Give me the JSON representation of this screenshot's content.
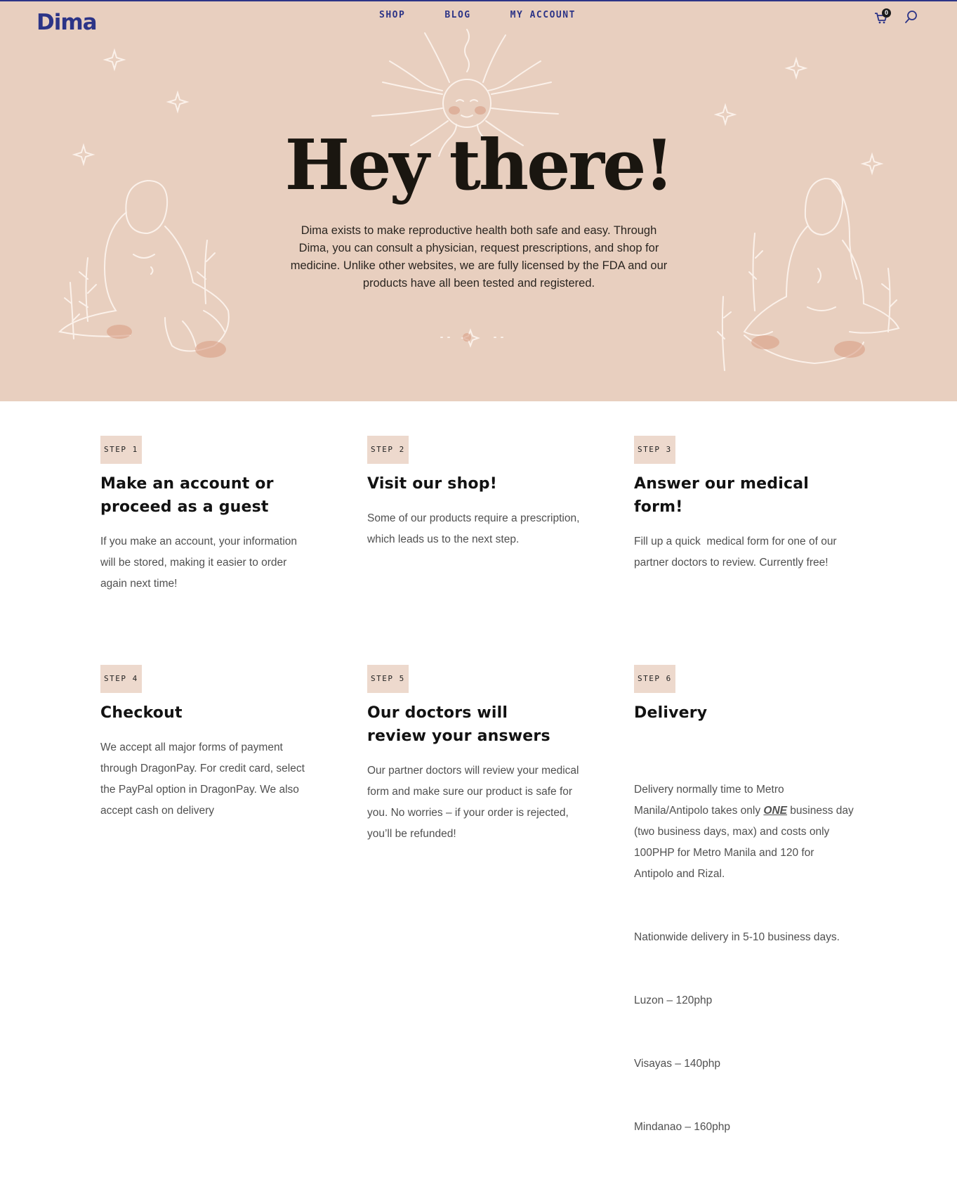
{
  "brand": {
    "logo": "Dima",
    "color": "#2c3487"
  },
  "nav": {
    "items": [
      "SHOP",
      "BLOG",
      "MY ACCOUNT"
    ]
  },
  "cart": {
    "count": "0"
  },
  "hero": {
    "title": "Hey there!",
    "text": "Dima exists to make reproductive health both safe and easy. Through Dima, you can consult a physician, request prescriptions, and shop for medicine. Unlike other websites, we are fully licensed by the FDA and our products have all been tested and registered.",
    "background": "#e8cfbf"
  },
  "steps": [
    {
      "badge": "STEP 1",
      "title": "Make an account or proceed as a guest",
      "desc": "If you make an account, your information will be stored, making it easier to order again next time!"
    },
    {
      "badge": "STEP 2",
      "title": "Visit our shop!",
      "desc": "Some of our products require a prescription, which leads us to the next step."
    },
    {
      "badge": "STEP 3",
      "title": "Answer our medical form!",
      "desc": "Fill up a quick  medical form for one of our partner doctors to review. Currently free!"
    },
    {
      "badge": "STEP 4",
      "title": "Checkout",
      "desc": "We accept all major forms of payment through DragonPay. For credit card, select the PayPal option in DragonPay. We also accept cash on delivery"
    },
    {
      "badge": "STEP 5",
      "title": "Our doctors will review your answers",
      "desc": "Our partner doctors will review your medical form and make sure our product is safe for you. No worries – if your order is rejected, you’ll be refunded!"
    },
    {
      "badge": "STEP 6",
      "title": "Delivery",
      "desc_a": "Delivery normally time to Metro Manila/Antipolo takes only ",
      "desc_emph": "ONE",
      "desc_b": " business day  (two business days, max) and costs only 100PHP for Metro Manila and 120 for Antipolo and Rizal.",
      "lines": [
        "Nationwide delivery in 5-10 business days.",
        "Luzon – 120php",
        "Visayas – 140php",
        "Mindanao – 160php"
      ]
    }
  ]
}
